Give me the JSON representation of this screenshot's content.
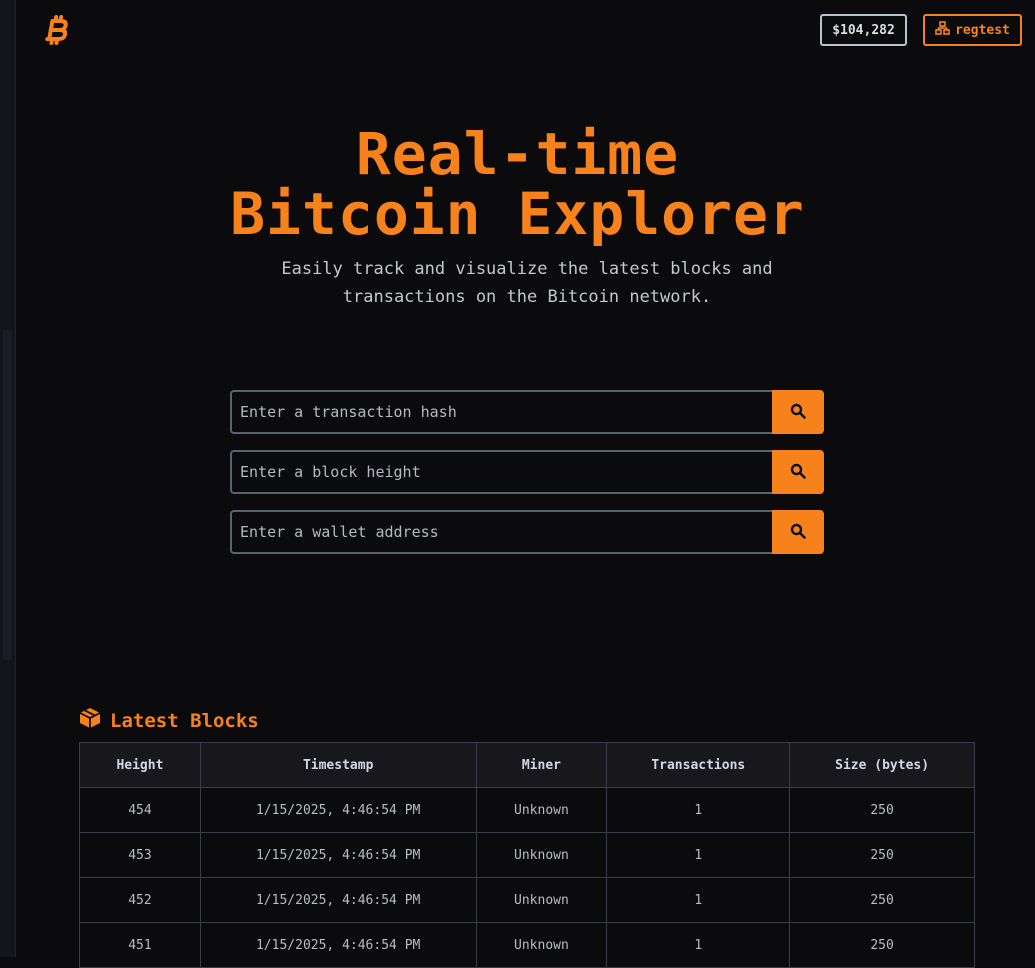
{
  "header": {
    "price": "$104,282",
    "network": "regtest",
    "logo_icon": "bitcoin-logo-icon",
    "accent_color": "#f7821b"
  },
  "hero": {
    "title_line1": "Real-time",
    "title_line2": "Bitcoin Explorer",
    "subtitle_line1": "Easily track and visualize the latest blocks and",
    "subtitle_line2": "transactions on the Bitcoin network."
  },
  "search": {
    "tx_placeholder": "Enter a transaction hash",
    "block_placeholder": "Enter a block height",
    "wallet_placeholder": "Enter a wallet address",
    "button_icon": "search-icon"
  },
  "latest_blocks": {
    "title": "Latest Blocks",
    "icon": "cube-icon",
    "columns": [
      "Height",
      "Timestamp",
      "Miner",
      "Transactions",
      "Size (bytes)"
    ],
    "rows": [
      [
        "454",
        "1/15/2025, 4:46:54 PM",
        "Unknown",
        "1",
        "250"
      ],
      [
        "453",
        "1/15/2025, 4:46:54 PM",
        "Unknown",
        "1",
        "250"
      ],
      [
        "452",
        "1/15/2025, 4:46:54 PM",
        "Unknown",
        "1",
        "250"
      ],
      [
        "451",
        "1/15/2025, 4:46:54 PM",
        "Unknown",
        "1",
        "250"
      ]
    ]
  }
}
